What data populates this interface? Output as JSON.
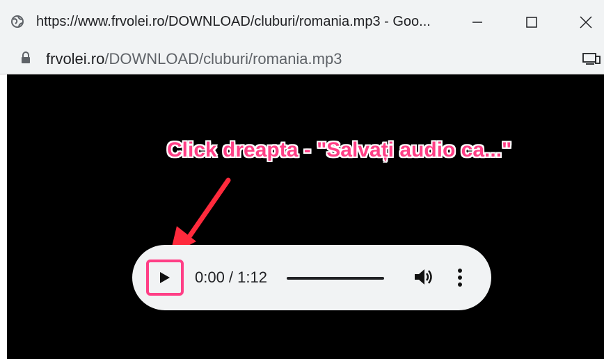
{
  "window": {
    "title": "https://www.frvolei.ro/DOWNLOAD/cluburi/romania.mp3 - Goo...",
    "minimize_icon": "minimize-icon",
    "maximize_icon": "maximize-icon",
    "close_icon": "close-icon"
  },
  "address": {
    "domain": "frvolei.ro",
    "path": "/DOWNLOAD/cluburi/romania.mp3"
  },
  "annotation": {
    "text": "Click dreapta - \"Salvați audio ca...\"",
    "color": "#ff3f86"
  },
  "player": {
    "time": "0:00 / 1:12",
    "progress": 0.0,
    "play_icon": "play-icon",
    "volume_icon": "volume-icon",
    "menu_icon": "more-vert-icon"
  }
}
